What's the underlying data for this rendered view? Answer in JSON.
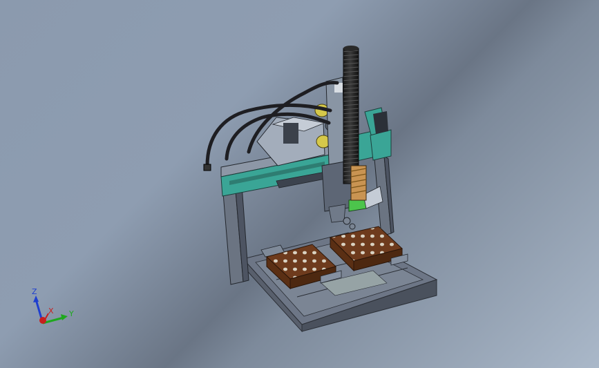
{
  "viewport": {
    "triad": {
      "z_label": "Z",
      "x_label": "X",
      "y_label": "Y",
      "z_color": "#1f3fcf",
      "x_color": "#c81e1e",
      "y_color": "#1ea81e"
    }
  },
  "model": {
    "frame_color": "#5d6675",
    "accent_color": "#3fa89a",
    "fixture_color": "#6b3a1e",
    "screw_color": "#222222",
    "hose_color": "#1e1e22"
  }
}
